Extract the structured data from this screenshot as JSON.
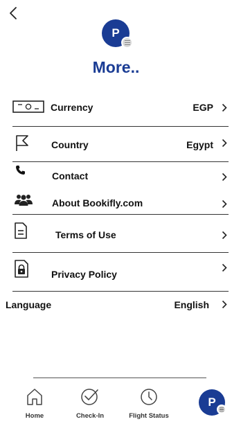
{
  "header": {
    "title": "More..",
    "avatar_initial": "P"
  },
  "menu": {
    "currency_label": "Currency",
    "currency_value": "EGP",
    "country_label": "Country",
    "country_value": "Egypt",
    "contact_label": "Contact",
    "about_label": "About Bookifly.com",
    "terms_label": "Terms of Use",
    "privacy_label": "Privacy Policy",
    "language_label": "Language",
    "language_value": "English"
  },
  "bottom_nav": {
    "home": "Home",
    "checkin": "Check-In",
    "flight_status": "Flight Status",
    "profile_initial": "P"
  },
  "colors": {
    "brand": "#1a3c94"
  }
}
